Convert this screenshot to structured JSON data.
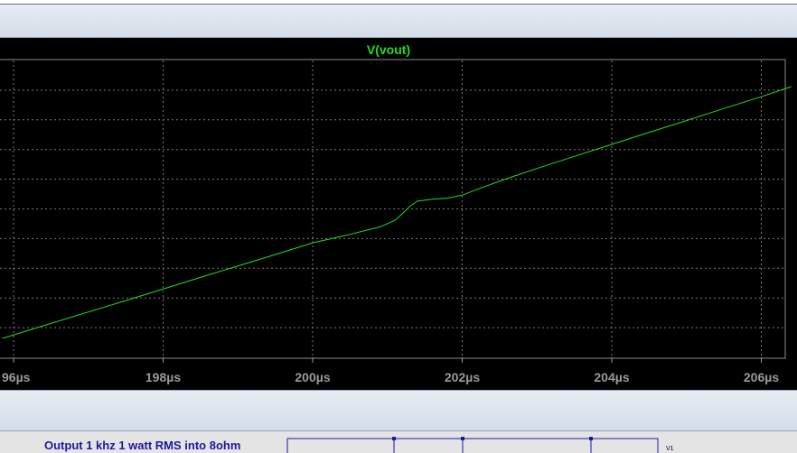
{
  "plot": {
    "trace_name": "V(vout)",
    "trace_color": "#22dd22"
  },
  "chart_data": {
    "type": "line",
    "title": "V(vout)",
    "xlabel": "",
    "ylabel": "",
    "x_tick_labels": [
      "96µs",
      "198µs",
      "200µs",
      "202µs",
      "204µs",
      "206µs"
    ],
    "xlim": [
      195.85,
      206.4
    ],
    "grid": true,
    "series": [
      {
        "name": "V(vout)",
        "x": [
          195.85,
          196.5,
          197.5,
          198.5,
          199.5,
          200.0,
          200.5,
          200.9,
          201.1,
          201.2,
          201.3,
          201.4,
          201.6,
          201.8,
          202.0,
          202.2,
          202.6,
          203.0,
          203.5,
          204.0,
          204.5,
          205.0,
          205.5,
          206.0,
          206.4
        ],
        "y": [
          0.0,
          0.46,
          1.16,
          1.87,
          2.57,
          2.93,
          3.19,
          3.42,
          3.62,
          3.82,
          4.05,
          4.21,
          4.27,
          4.3,
          4.39,
          4.57,
          4.9,
          5.21,
          5.58,
          5.95,
          6.32,
          6.68,
          7.05,
          7.41,
          7.72
        ]
      }
    ]
  },
  "schematic": {
    "text": "Output 1 khz 1 watt RMS into 8ohm",
    "component_label": "V1"
  }
}
